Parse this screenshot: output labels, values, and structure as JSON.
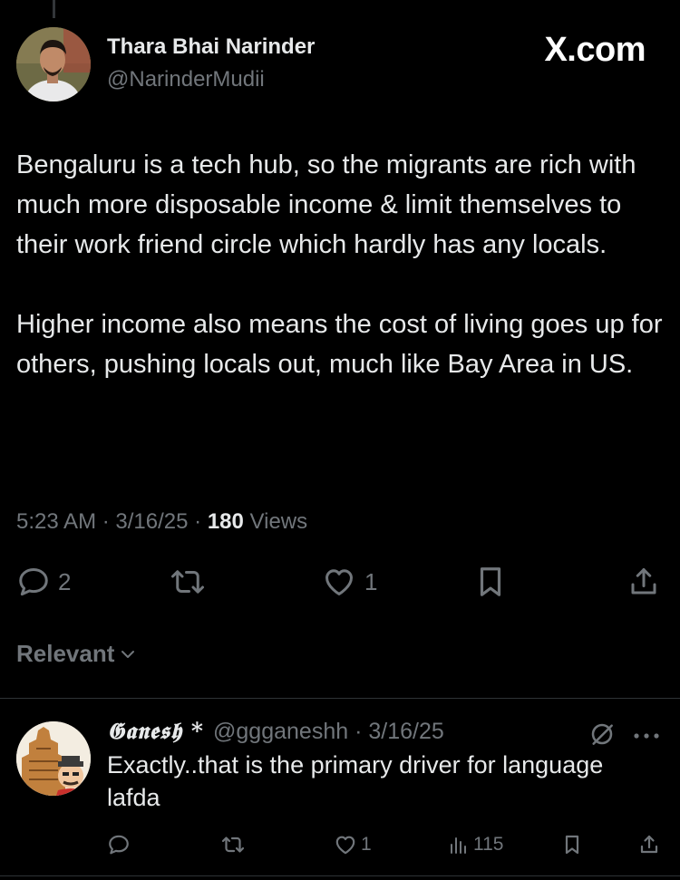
{
  "brand": "X.com",
  "tweet": {
    "author_name": "Thara Bhai Narinder",
    "author_handle": "@NarinderMudii",
    "paragraphs": [
      "Bengaluru is a tech hub, so the migrants are rich with much more disposable income & limit themselves to their work friend circle which hardly has any locals.",
      "Higher income also means the cost of living goes up for others, pushing locals out, much like Bay Area in US."
    ],
    "time": "5:23 AM",
    "date": "3/16/25",
    "views_count": "180",
    "views_label": "Views",
    "separator": "·",
    "actions": {
      "replies": "2",
      "likes": "1"
    }
  },
  "sort": {
    "label": "Relevant"
  },
  "reply": {
    "name": "𝕲𝖆𝖓𝖊𝖘𝖍 *",
    "handle_date": "@ggganeshh · 3/16/25",
    "text": "Exactly..that is the primary driver for language lafda",
    "actions": {
      "likes": "1",
      "views": "115"
    }
  },
  "icons": {
    "reply": "speech-bubble-icon",
    "retweet": "retweet-icon",
    "like": "heart-icon",
    "bookmark": "bookmark-icon",
    "share": "share-upload-icon",
    "views": "bar-chart-icon",
    "grok": "grok-icon",
    "more": "more-dots-icon",
    "chevron": "chevron-down-icon"
  },
  "colors": {
    "background": "#000000",
    "text": "#e7e9ea",
    "muted": "#71767b",
    "divider": "#2f3336"
  }
}
